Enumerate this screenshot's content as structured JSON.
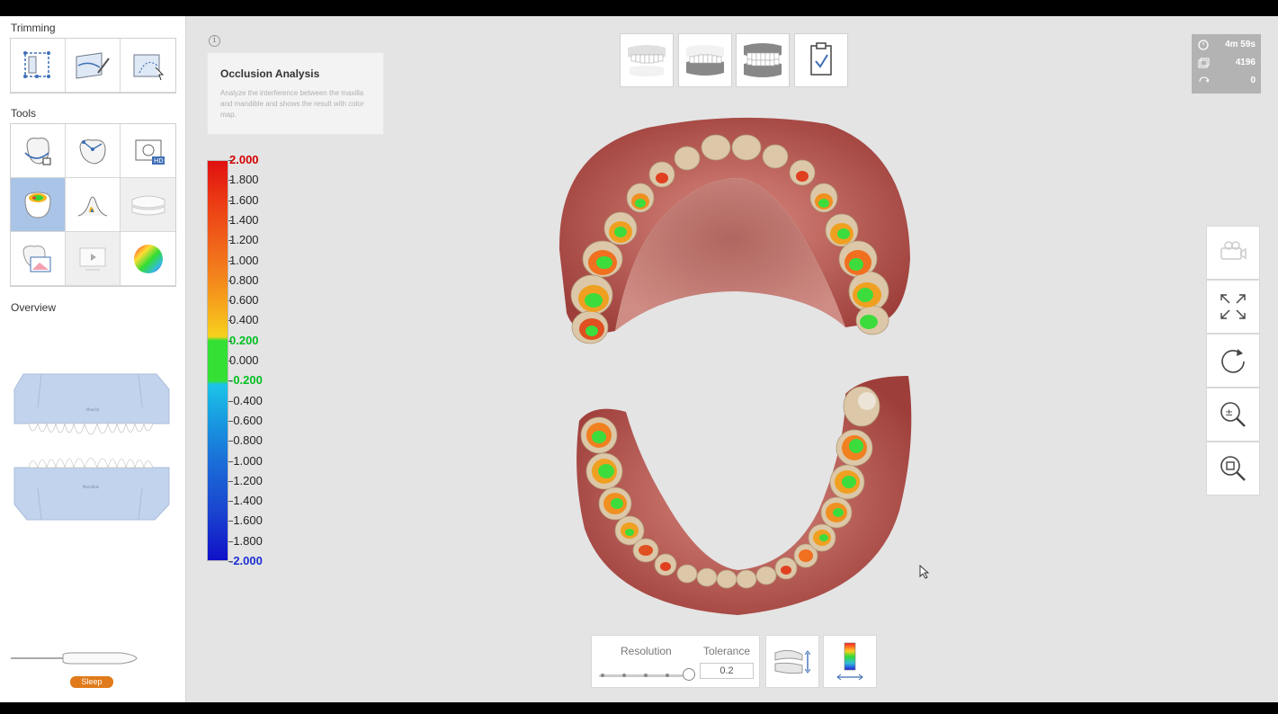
{
  "left_panel": {
    "trimming_title": "Trimming",
    "tools_title": "Tools",
    "overview_title": "Overview",
    "trimming_tools": [
      {
        "name": "select-area-trim-icon"
      },
      {
        "name": "brush-trim-icon"
      },
      {
        "name": "lasso-trim-icon"
      }
    ],
    "tools": [
      {
        "name": "lock-margin-icon",
        "state": "normal"
      },
      {
        "name": "fill-holes-icon",
        "state": "normal"
      },
      {
        "name": "hd-capture-icon",
        "state": "normal"
      },
      {
        "name": "occlusion-analysis-icon",
        "state": "active"
      },
      {
        "name": "undercut-analysis-icon",
        "state": "normal"
      },
      {
        "name": "bite-align-icon",
        "state": "disabled"
      },
      {
        "name": "tooth-image-icon",
        "state": "normal"
      },
      {
        "name": "video-icon",
        "state": "disabled"
      },
      {
        "name": "color-sphere-icon",
        "state": "normal"
      }
    ],
    "overview": {
      "maxilla_label": "Maxilla",
      "mandible_label": "Mandible"
    },
    "scanner_status": "Sleep"
  },
  "info": {
    "icon": "info-icon",
    "title": "Occlusion Analysis",
    "description": "Analyze the interference between the maxilla and mandible and shows the result with color map."
  },
  "colorbar": {
    "labels": [
      "2.000",
      "1.800",
      "1.600",
      "1.400",
      "1.200",
      "1.000",
      "0.800",
      "0.600",
      "0.400",
      "0.200",
      "0.000",
      "-0.200",
      "-0.400",
      "-0.600",
      "-0.800",
      "-1.000",
      "-1.200",
      "-1.400",
      "-1.600",
      "-1.800",
      "-2.000"
    ],
    "highlight": {
      "2.000": "red",
      "0.200": "green",
      "-0.200": "green",
      "-2.000": "blue"
    }
  },
  "top_views": [
    {
      "name": "maxilla-view-icon"
    },
    {
      "name": "mandible-view-icon"
    },
    {
      "name": "occlusion-view-icon"
    },
    {
      "name": "checklist-icon"
    }
  ],
  "stats": {
    "time": "4m 59s",
    "shots": "4196",
    "retries": "0"
  },
  "right_toolbar": [
    {
      "name": "camera-icon",
      "disabled": true
    },
    {
      "name": "fit-screen-icon"
    },
    {
      "name": "rotate-icon"
    },
    {
      "name": "zoom-icon"
    },
    {
      "name": "zoom-fit-icon"
    }
  ],
  "bottom": {
    "resolution_label": "Resolution",
    "tolerance_label": "Tolerance",
    "tolerance_value": "0.2",
    "resolution_level": 1.0
  },
  "colors": {
    "accent_active": "#a9c4e6",
    "sleep_badge": "#e07a1a",
    "gum": "#b8534f",
    "tooth": "#d8c7a8"
  }
}
